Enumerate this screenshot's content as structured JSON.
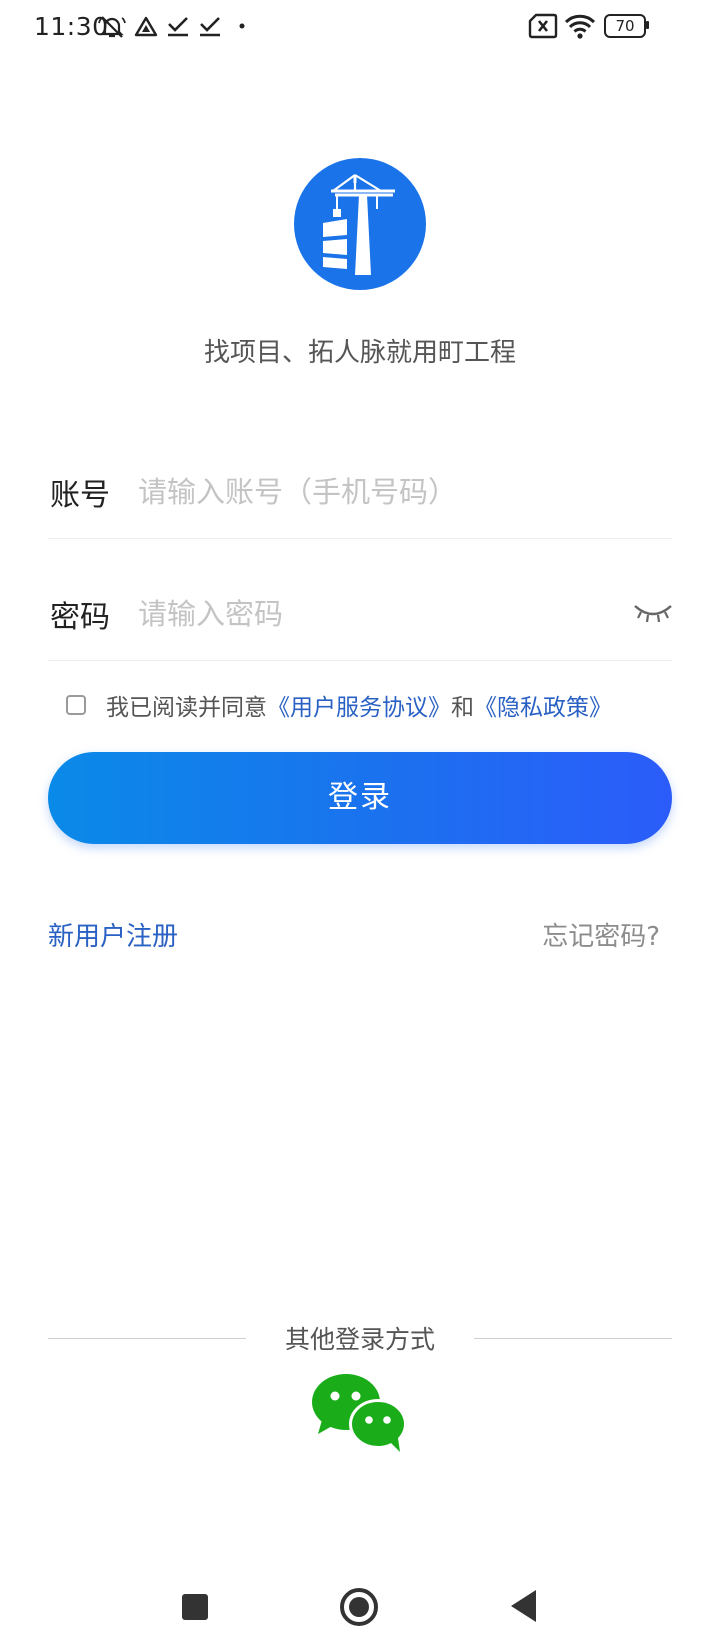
{
  "status_bar": {
    "time": "11:30",
    "battery": "70",
    "icons": [
      "mute-icon",
      "drive-icon",
      "check-icon",
      "check-icon",
      "dot-icon",
      "no-sim-icon",
      "wifi-icon",
      "battery-icon"
    ]
  },
  "brand": {
    "logo": "crane-logo-icon",
    "slogan": "找项目、拓人脉就用町工程",
    "color": "#1a73e8"
  },
  "form": {
    "account": {
      "label": "账号",
      "placeholder": "请输入账号（手机号码）",
      "value": ""
    },
    "password": {
      "label": "密码",
      "placeholder": "请输入密码",
      "value": "",
      "toggle_icon": "eye-closed-icon"
    },
    "agreement": {
      "checked": false,
      "prefix": "我已阅读并同意",
      "terms_link": "《用户服务协议》",
      "conjunction": "和",
      "privacy_link": "《隐私政策》"
    },
    "login_label": "登录"
  },
  "links": {
    "register": "新用户注册",
    "forgot_password": "忘记密码?"
  },
  "other_login": {
    "title": "其他登录方式",
    "methods": [
      "wechat-icon"
    ]
  },
  "colors": {
    "link": "#2a61c4",
    "button_start": "#0a8ae8",
    "button_end": "#2b5cfa",
    "wechat": "#1aad19"
  },
  "nav_bar": {
    "buttons": [
      "recents-button",
      "home-button",
      "back-button"
    ]
  }
}
